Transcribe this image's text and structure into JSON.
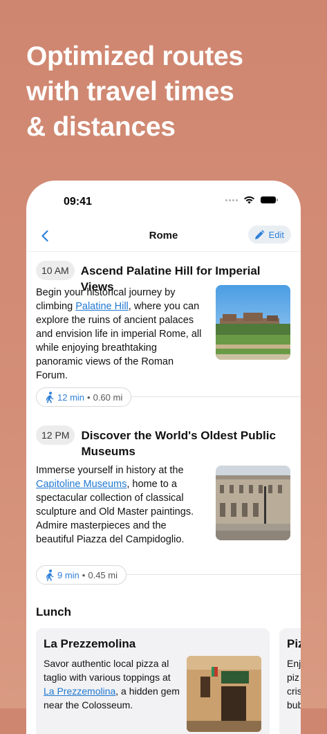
{
  "headline": "Optimized routes\nwith travel times\n& distances",
  "status_bar": {
    "time": "09:41"
  },
  "nav": {
    "title": "Rome",
    "edit_label": "Edit"
  },
  "sections": [
    {
      "time": "10 AM",
      "title": "Ascend Palatine Hill for Imperial Views",
      "desc_before": "Begin your historical journey by climbing ",
      "link": "Palatine Hill",
      "desc_after": ", where you can explore the ruins of ancient palaces and envision life in imperial Rome, all while enjoying breathtaking panoramic views of the Roman Forum."
    },
    {
      "time": "12 PM",
      "title": "Discover the World's Oldest Public Museums",
      "desc_before": "Immerse yourself in history at the ",
      "link": "Capitoline Museums",
      "desc_after": ", home to a spectacular collection of classical sculpture and Old Master paintings. Admire masterpieces and the beautiful Piazza del Campidoglio."
    }
  ],
  "transits": [
    {
      "minutes": "12 min",
      "separator": "•",
      "distance": "0.60 mi"
    },
    {
      "minutes": "9 min",
      "separator": "•",
      "distance": "0.45 mi"
    }
  ],
  "lunch": {
    "heading": "Lunch",
    "cards": [
      {
        "title": "La Prezzemolina",
        "desc_before": "Savor authentic local pizza al taglio with various toppings at ",
        "link": "La Prezzemolina",
        "desc_after": ", a hidden gem near the Colosseum."
      },
      {
        "title": "Piz",
        "desc_lines": [
          "Enj",
          "piz",
          "cris",
          "bub"
        ]
      }
    ]
  },
  "icons": {
    "back": "chevron-left-icon",
    "edit": "pencil-icon",
    "walk": "walking-person-icon",
    "wifi": "wifi-icon",
    "battery": "battery-icon"
  },
  "colors": {
    "background": "#cf8670",
    "accent": "#2f80d8",
    "link": "#1f78d1"
  }
}
